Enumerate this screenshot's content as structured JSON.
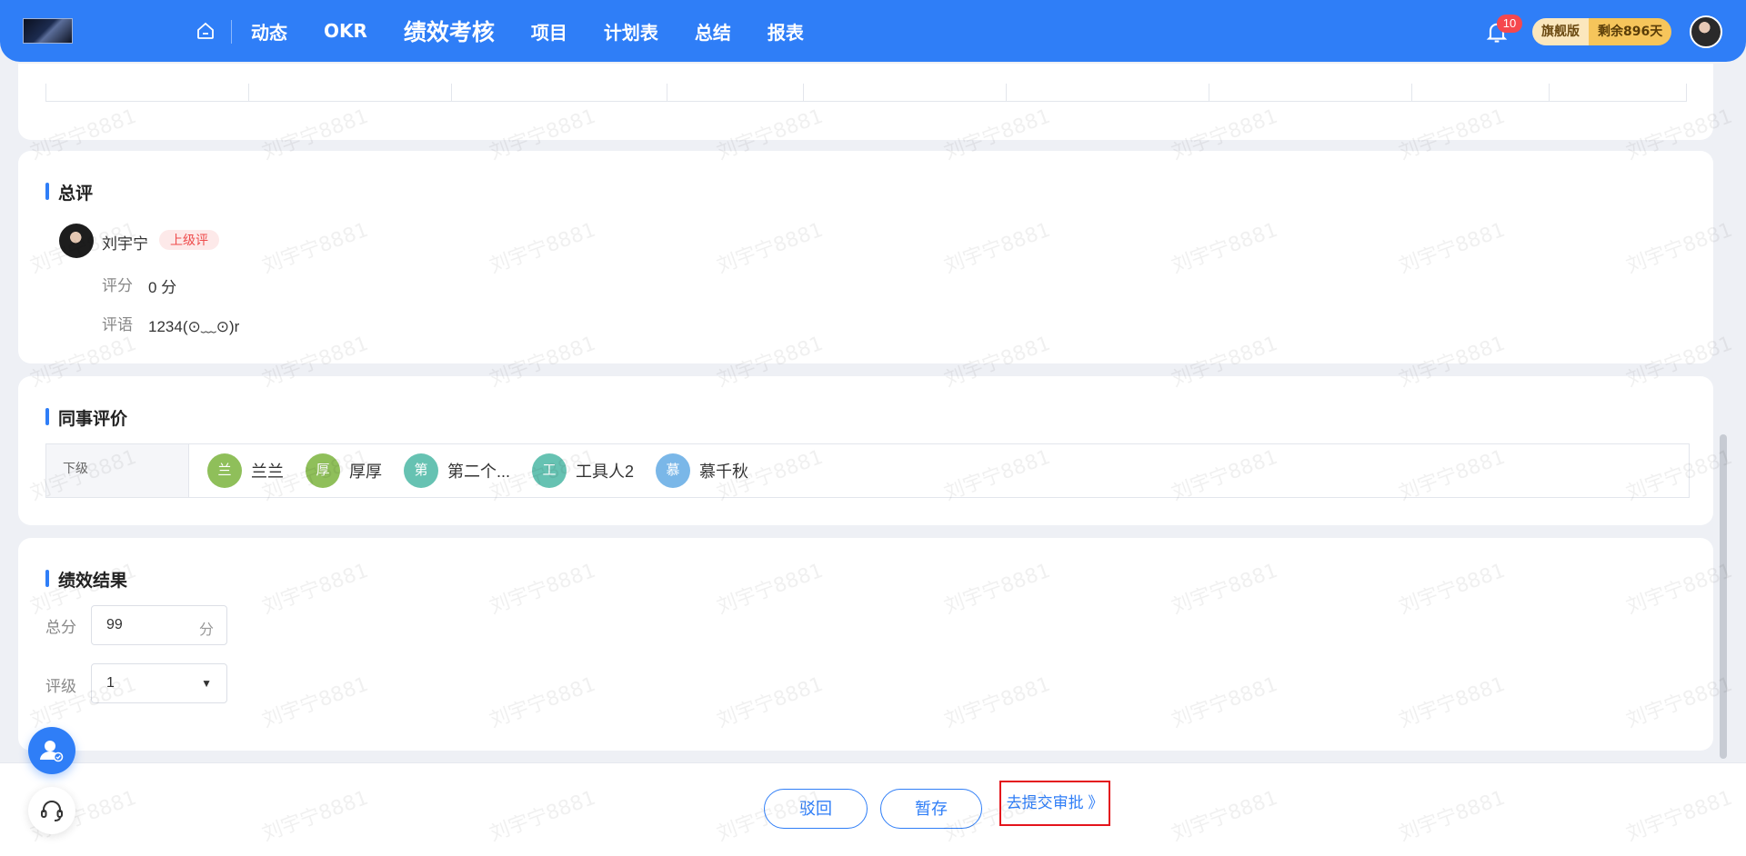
{
  "nav": {
    "items": [
      "动态",
      "OKR",
      "绩效考核",
      "项目",
      "计划表",
      "总结",
      "报表"
    ],
    "active": "绩效考核",
    "notification_count": "10",
    "plan_name": "旗舰版",
    "plan_remaining": "剩余896天"
  },
  "overall": {
    "title": "总评",
    "reviewer_name": "刘宇宁",
    "reviewer_tag": "上级评",
    "score_label": "评分",
    "score_value": "0 分",
    "comment_label": "评语",
    "comment_value": "1234(⊙﹏⊙)r"
  },
  "colleague": {
    "title": "同事评价",
    "row_label": "下级",
    "people": [
      {
        "initial": "兰",
        "name": "兰兰",
        "color": "#8fbf5a"
      },
      {
        "initial": "厚",
        "name": "厚厚",
        "color": "#8fbf5a"
      },
      {
        "initial": "第",
        "name": "第二个...",
        "color": "#66c2b2"
      },
      {
        "initial": "工",
        "name": "工具人2",
        "color": "#66c2b2"
      },
      {
        "initial": "慕",
        "name": "慕千秋",
        "color": "#7ab7e8"
      }
    ]
  },
  "result": {
    "title": "绩效结果",
    "total_label": "总分",
    "total_value": "99",
    "total_unit": "分",
    "grade_label": "评级",
    "grade_value": "1"
  },
  "actions": {
    "reject": "驳回",
    "save_draft": "暂存",
    "submit": "去提交审批 》"
  },
  "watermark": "刘宇宁8881",
  "colors": {
    "primary": "#2f7ef7",
    "danger": "#ee4b4b",
    "highlight": "#e4141c"
  }
}
